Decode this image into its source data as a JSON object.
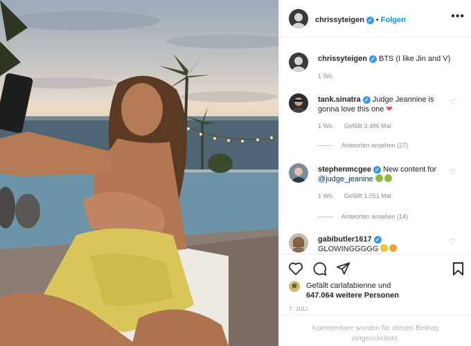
{
  "post": {
    "author": "chrissyteigen",
    "follow_label": "Folgen",
    "separator": "•",
    "more_label": "•••"
  },
  "caption": {
    "user": "chrissyteigen",
    "text": "BTS (I like Jin and V)",
    "time": "1 Wo."
  },
  "comments": [
    {
      "user": "tank.sinatra",
      "text": "Judge Jeannine is gonna love this one",
      "time": "1 Wo.",
      "likes": "Gefällt 3.486 Mal",
      "replies": "Antworten ansehen (27)"
    },
    {
      "user": "stephenmcgee",
      "text_before": "New content for ",
      "mention": "@judge_jeanine",
      "time": "1 Wo.",
      "likes": "Gefällt 1.051 Mal",
      "replies": "Antworten ansehen (14)"
    },
    {
      "user": "gabibutler1617",
      "text": "GLOWINGGGGG"
    }
  ],
  "likes_line1": "Gefällt carlafabienne und",
  "likes_line2": "647.064 weitere Personen",
  "date": "7. JULI",
  "footer_text": "Kommentare wurden für diesen Beitrag eingeschränkt.",
  "icons": {
    "like": "heart-icon",
    "comment": "comment-icon",
    "share": "share-icon",
    "save": "bookmark-icon",
    "more": "more-icon",
    "verified": "verified-badge-icon"
  },
  "colors": {
    "accent": "#0095f6",
    "verified": "#3897f0",
    "muted": "#8e8e8e",
    "red_heart": "#ed4956"
  }
}
